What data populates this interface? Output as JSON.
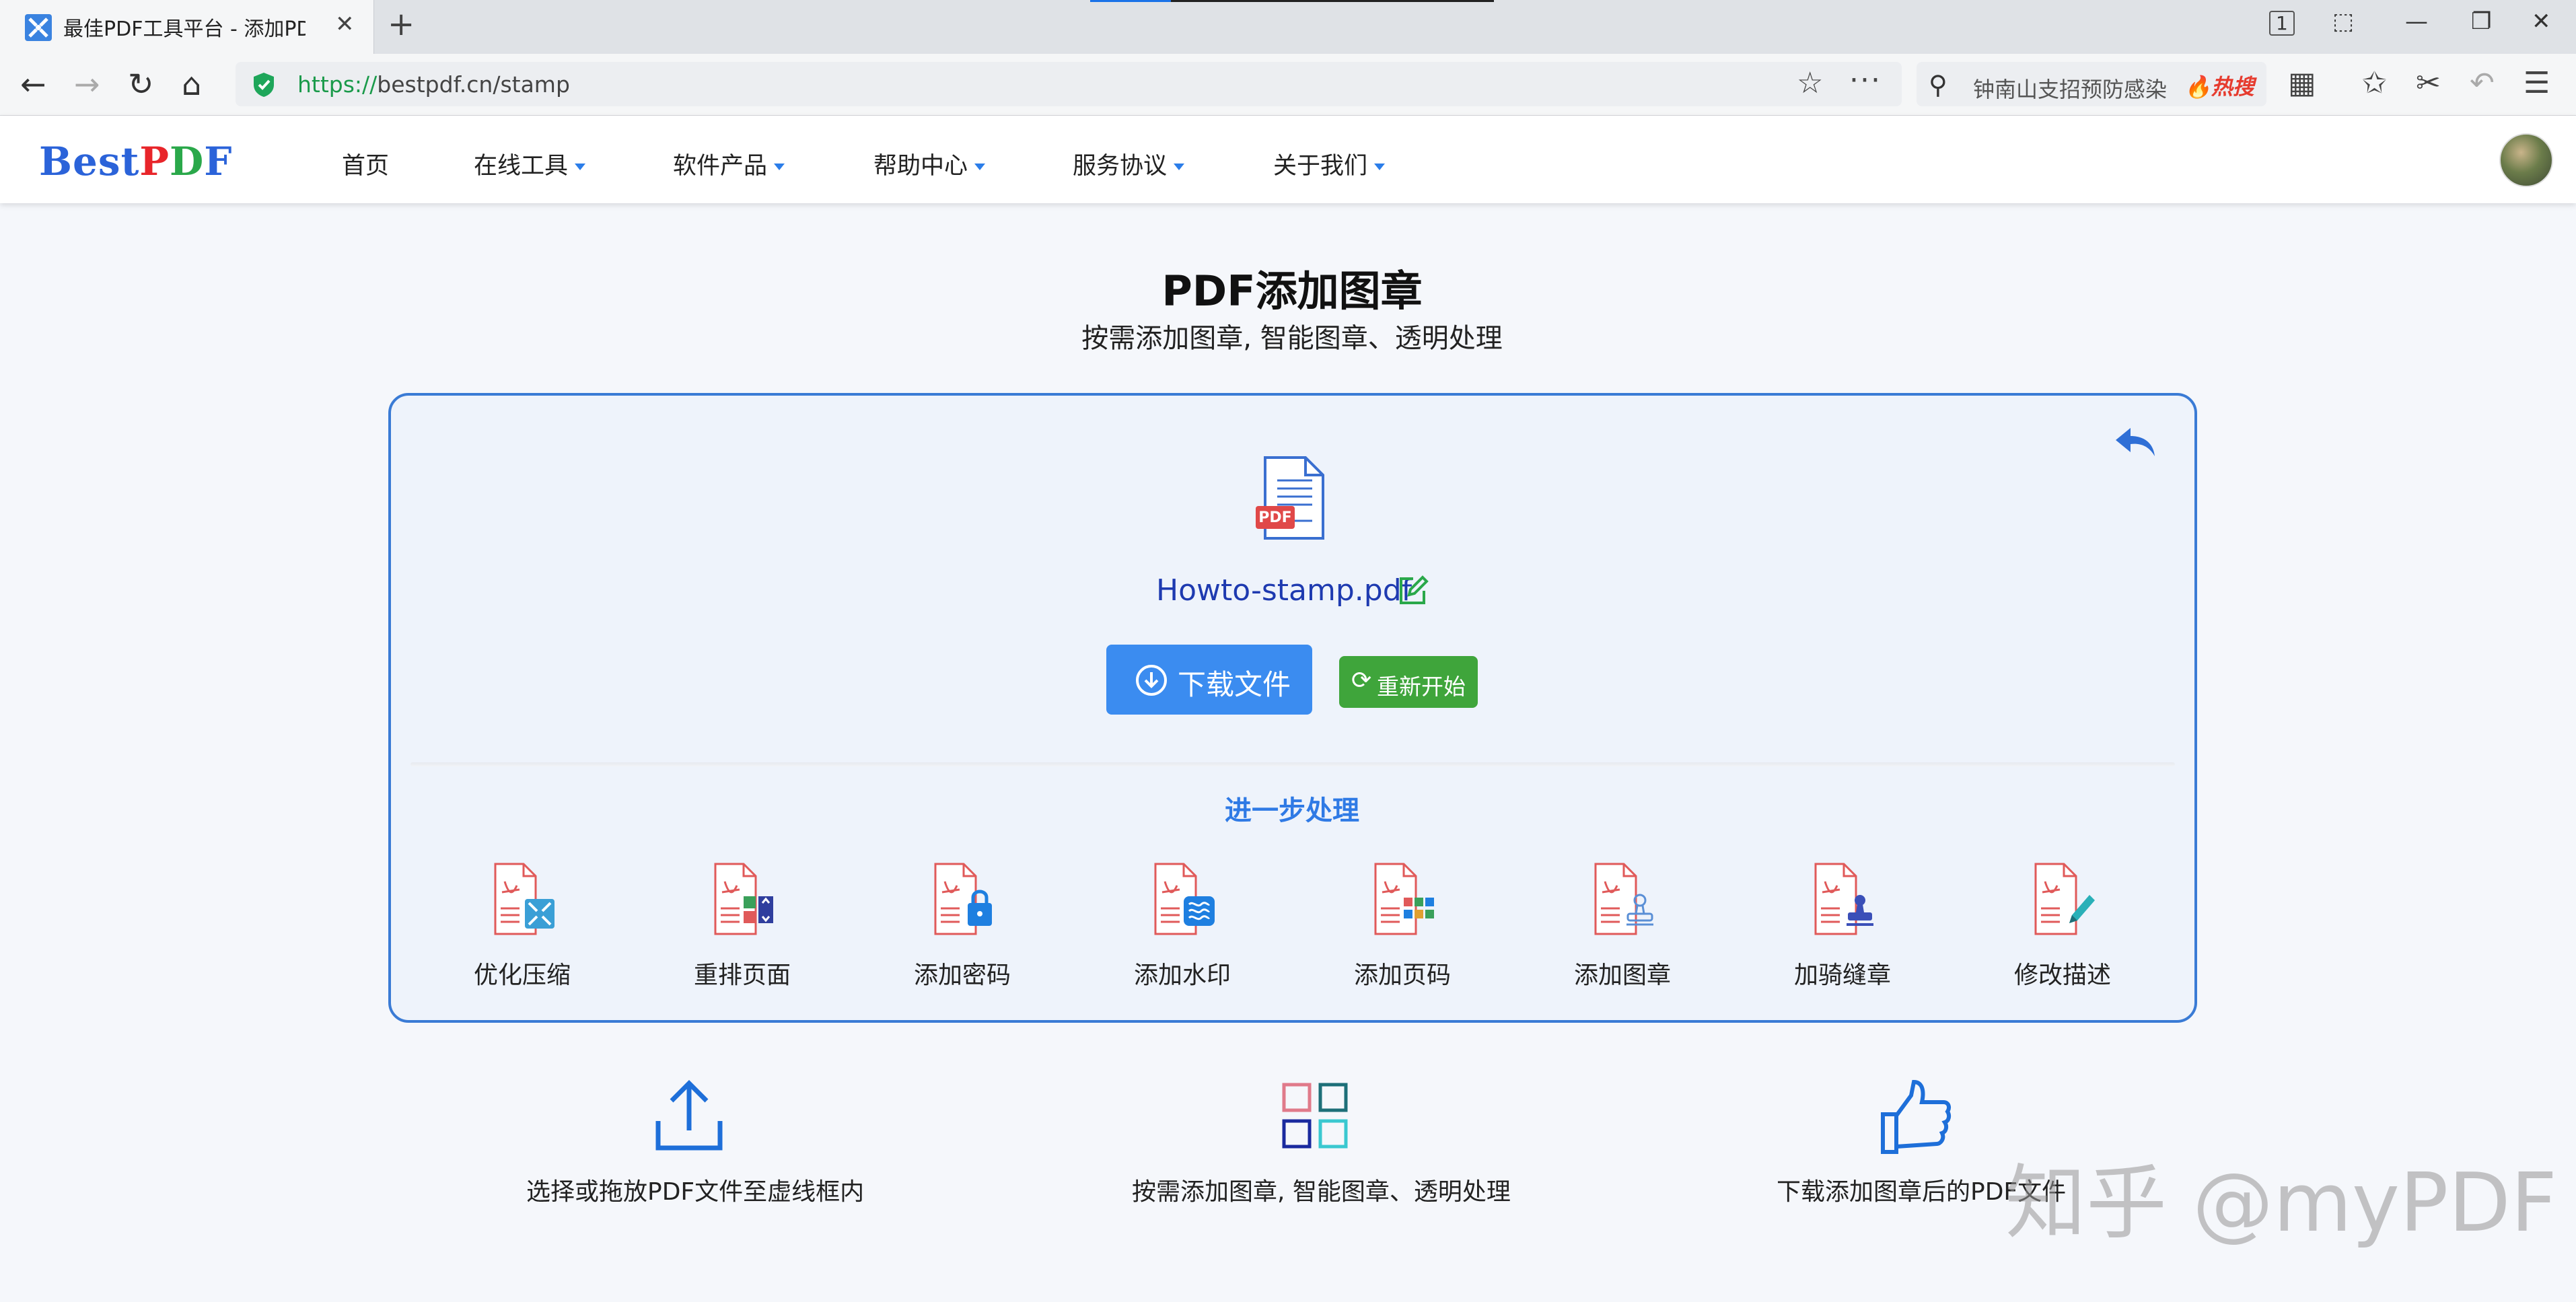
{
  "browser": {
    "tab_title": "最佳PDF工具平台 - 添加PDF",
    "tab_close": "✕",
    "new_tab": "+",
    "url_scheme": "https://",
    "url_rest": "bestpdf.cn/stamp",
    "search_query": "钟南山支招预防感染",
    "search_hot": "🔥热搜",
    "window_buttons": [
      "1",
      "⬚",
      "—",
      "❐",
      "✕"
    ]
  },
  "header": {
    "logo": {
      "b": "Best",
      "p": "P",
      "d": "D",
      "f": "F"
    },
    "menu": [
      {
        "label": "首页",
        "has_dropdown": false
      },
      {
        "label": "在线工具",
        "has_dropdown": true
      },
      {
        "label": "软件产品",
        "has_dropdown": true
      },
      {
        "label": "帮助中心",
        "has_dropdown": true
      },
      {
        "label": "服务协议",
        "has_dropdown": true
      },
      {
        "label": "关于我们",
        "has_dropdown": true
      }
    ]
  },
  "main": {
    "title": "PDF添加图章",
    "subtitle": "按需添加图章, 智能图章、透明处理",
    "file_name": "Howto-stamp.pdf",
    "download_label": "下载文件",
    "restart_label": "重新开始",
    "further_title": "进一步处理",
    "tools": [
      {
        "label": "优化压缩",
        "icon": "compress-icon"
      },
      {
        "label": "重排页面",
        "icon": "reorder-icon"
      },
      {
        "label": "添加密码",
        "icon": "lock-icon"
      },
      {
        "label": "添加水印",
        "icon": "watermark-icon"
      },
      {
        "label": "添加页码",
        "icon": "page-number-icon"
      },
      {
        "label": "添加图章",
        "icon": "stamp-icon"
      },
      {
        "label": "加骑缝章",
        "icon": "seam-stamp-icon"
      },
      {
        "label": "修改描述",
        "icon": "edit-description-icon"
      }
    ]
  },
  "steps": [
    {
      "text": "选择或拖放PDF文件至虚线框内",
      "icon": "upload-icon"
    },
    {
      "text": "按需添加图章, 智能图章、透明处理",
      "icon": "grid-icon"
    },
    {
      "text": "下载添加图章后的PDF文件",
      "icon": "thumbs-up-icon"
    }
  ],
  "watermark": "知乎 @myPDF",
  "colors": {
    "accent": "#3b8cf0",
    "restart": "#3fa53b",
    "card_border": "#3a7bd5",
    "pdf_red": "#e04848"
  }
}
